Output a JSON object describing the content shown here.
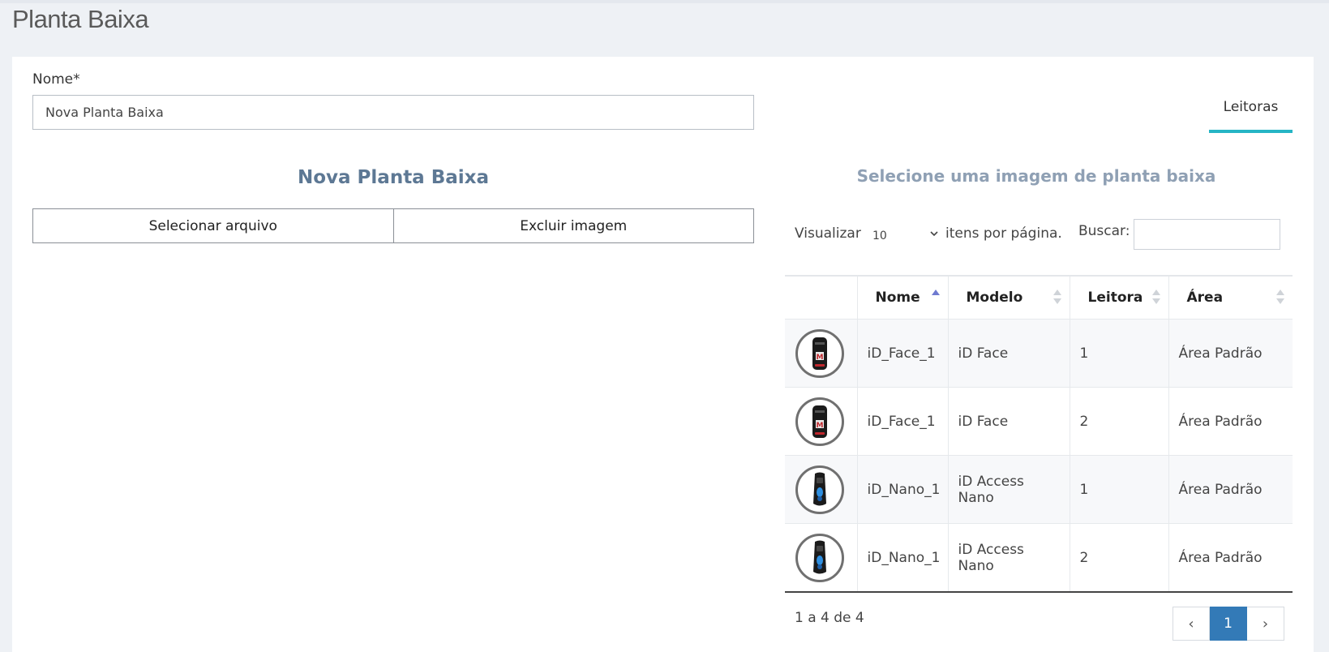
{
  "page": {
    "title": "Planta Baixa"
  },
  "form": {
    "name_label": "Nome*",
    "name_value": "Nova Planta Baixa"
  },
  "tabs": {
    "leitoras": "Leitoras"
  },
  "floorplan": {
    "heading": "Nova Planta Baixa",
    "select_file_label": "Selecionar arquivo",
    "delete_image_label": "Excluir imagem"
  },
  "readers": {
    "heading": "Selecione uma imagem de planta baixa",
    "length_prefix": "Visualizar",
    "page_size": "10",
    "length_suffix": "itens por página.",
    "search_label": "Buscar:",
    "search_value": "",
    "columns": [
      "",
      "Nome",
      "Modelo",
      "Leitora",
      "Área"
    ],
    "rows": [
      {
        "icon": "id-face-device-icon",
        "name": "iD_Face_1",
        "model": "iD Face",
        "reader": "1",
        "area": "Área Padrão"
      },
      {
        "icon": "id-face-device-icon",
        "name": "iD_Face_1",
        "model": "iD Face",
        "reader": "2",
        "area": "Área Padrão"
      },
      {
        "icon": "id-nano-device-icon",
        "name": "iD_Nano_1",
        "model": "iD Access Nano",
        "reader": "1",
        "area": "Área Padrão"
      },
      {
        "icon": "id-nano-device-icon",
        "name": "iD_Nano_1",
        "model": "iD Access Nano",
        "reader": "2",
        "area": "Área Padrão"
      }
    ],
    "info": "1 a 4 de 4",
    "pagination": {
      "prev": "‹",
      "current": "1",
      "next": "›"
    }
  },
  "colors": {
    "accent_tab": "#26b5c5",
    "pagination_active": "#337ab7",
    "heading_left": "#5d7894",
    "heading_right": "#8fa0b4"
  }
}
